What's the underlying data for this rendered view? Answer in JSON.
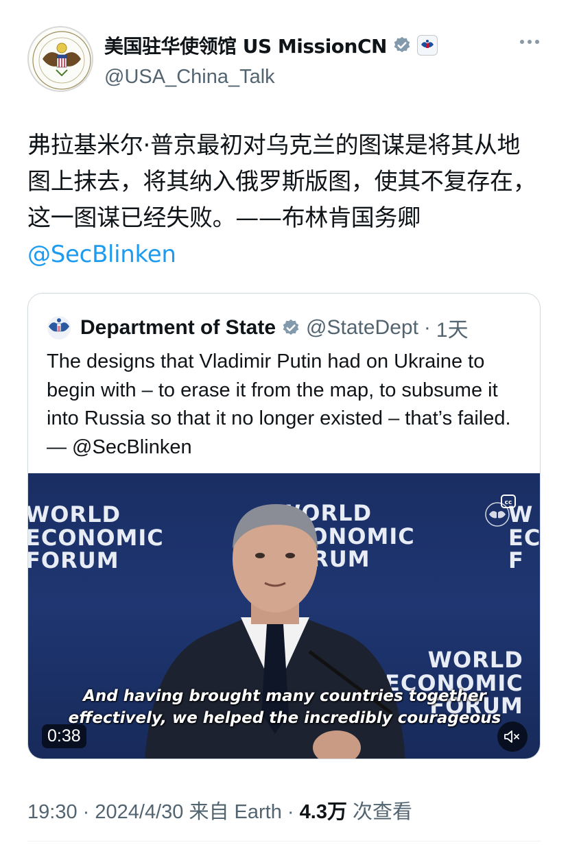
{
  "author": {
    "display_name": "美国驻华使领馆 US MissionCN",
    "handle": "@USA_China_Talk"
  },
  "tweet": {
    "text": "弗拉基米尔·普京最初对乌克兰的图谋是将其从地图上抹去，将其纳入俄罗斯版图，使其不复存在，这一图谋已经失败。——布林肯国务卿",
    "mention": "@SecBlinken"
  },
  "quoted": {
    "name": "Department of State",
    "handle": "@StateDept",
    "separator": "·",
    "time": "1天",
    "text": "The designs that Vladimir Putin had on Ukraine to begin with – to erase it from the map, to subsume it into Russia so that it no longer existed – that’s failed. — @SecBlinken",
    "video": {
      "logo_left": "WORLD\nECONOMIC\nFORUM",
      "logo_center": "WORLD\nECONOMIC\nFORUM",
      "logo_bottom": "WORLD\nECONOMIC\nFORUM",
      "logo_right": "W\nEC\nF",
      "subtitle_line1": "And having brought many countries together",
      "subtitle_line2": "effectively, we helped the incredibly courageous",
      "duration": "0:38"
    }
  },
  "meta": {
    "time": "19:30",
    "date": "2024/4/30",
    "source_prefix": "来自",
    "source": "Earth",
    "views": "4.3万",
    "views_label": "次查看",
    "dot": "·"
  },
  "icons": {
    "verified": "verified-badge-icon",
    "government": "government-seal-icon",
    "more": "more-dots-icon",
    "mute": "mute-icon",
    "captions": "closed-captions-icon"
  },
  "colors": {
    "link": "#1d9bf0",
    "secondary_text": "#536471",
    "verified_gray": "#829aab",
    "video_bg": "#1f3672"
  }
}
